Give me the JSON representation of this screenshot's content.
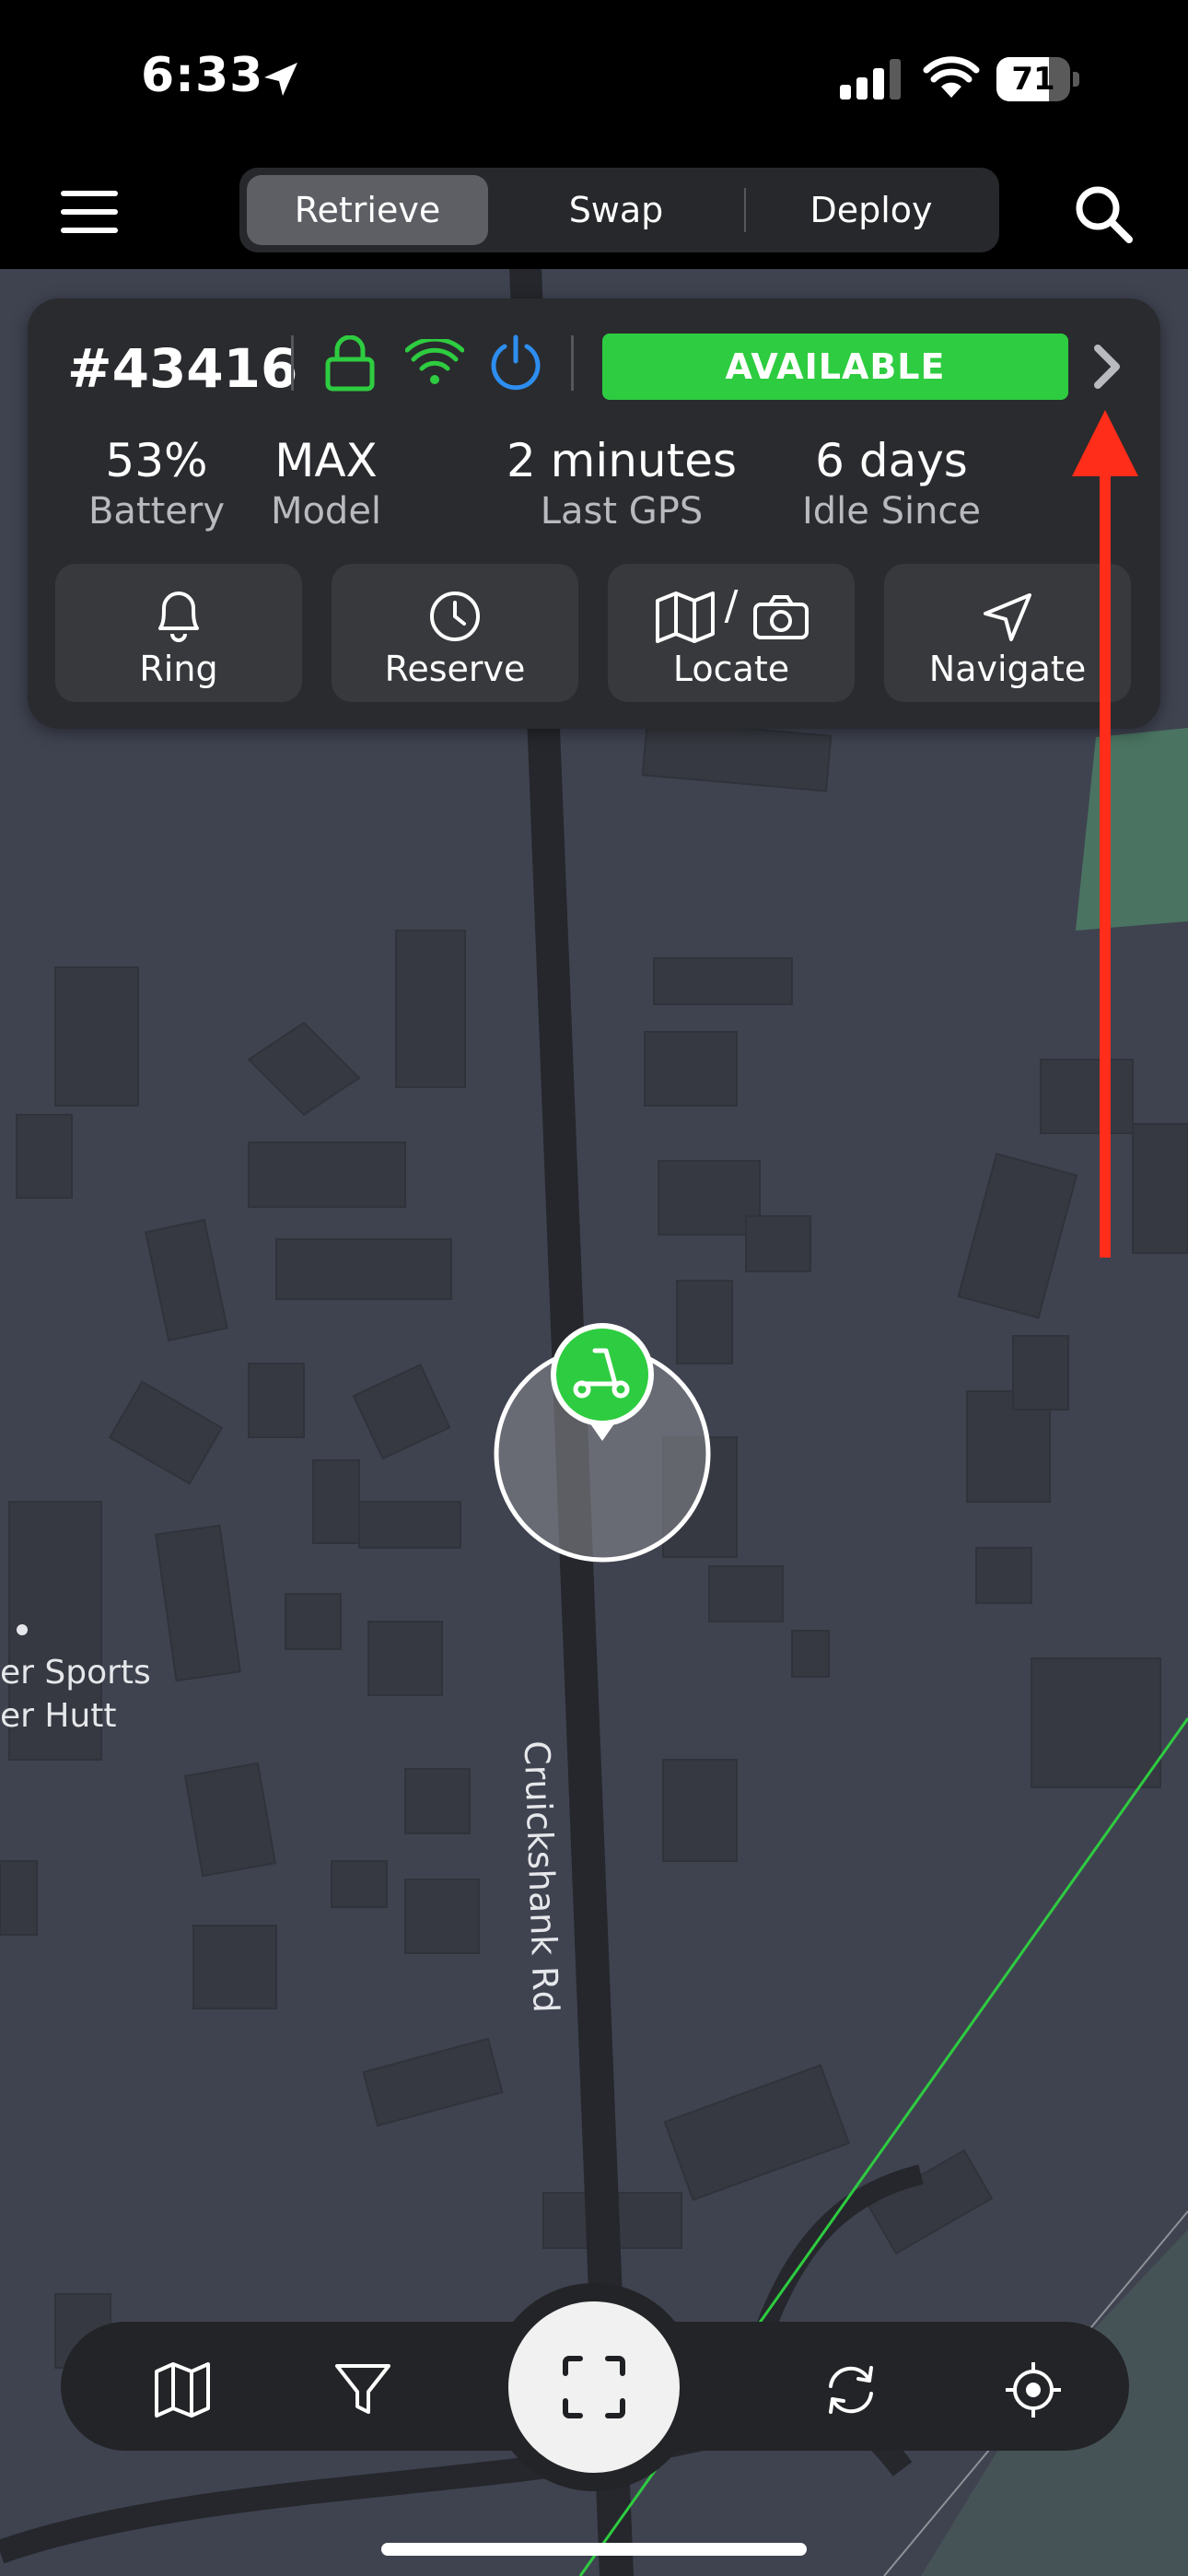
{
  "status_bar": {
    "time": "6:33",
    "battery_percent": "71",
    "battery_level": 0.71,
    "icons": [
      "location-arrow-icon",
      "cellular-signal-icon",
      "wifi-icon",
      "battery-icon"
    ]
  },
  "nav": {
    "menu_icon": "hamburger-menu-icon",
    "tabs": [
      {
        "label": "Retrieve",
        "active": true
      },
      {
        "label": "Swap",
        "active": false
      },
      {
        "label": "Deploy",
        "active": false
      }
    ],
    "search_icon": "search-icon"
  },
  "scooter": {
    "id": "#43416",
    "status": "AVAILABLE",
    "status_color": "#2ecc40",
    "icons": [
      "lock-icon",
      "wifi-icon",
      "power-icon",
      "chevron-right-icon"
    ],
    "stats": [
      {
        "value": "53%",
        "label": "Battery"
      },
      {
        "value": "MAX",
        "label": "Model"
      },
      {
        "value": "2 minutes",
        "label": "Last GPS"
      },
      {
        "value": "6 days",
        "label": "Idle Since"
      }
    ],
    "actions": [
      {
        "label": "Ring",
        "icon": "bell-icon"
      },
      {
        "label": "Reserve",
        "icon": "clock-icon"
      },
      {
        "label": "Locate",
        "icon": "map-camera-icon",
        "separator": "/"
      },
      {
        "label": "Navigate",
        "icon": "navigation-arrow-icon"
      }
    ]
  },
  "map": {
    "road_label": "Cruickshank Rd",
    "poi_line1": "er Sports",
    "poi_line2": "er Hutt",
    "marker_icon": "scooter-icon",
    "accent_color": "#2ecc40"
  },
  "bottom_bar": {
    "icons": [
      "map-icon",
      "filter-icon",
      "scan-icon",
      "refresh-icon",
      "locate-crosshair-icon"
    ]
  },
  "annotation": {
    "color": "#ff2d1a",
    "type": "arrow"
  }
}
